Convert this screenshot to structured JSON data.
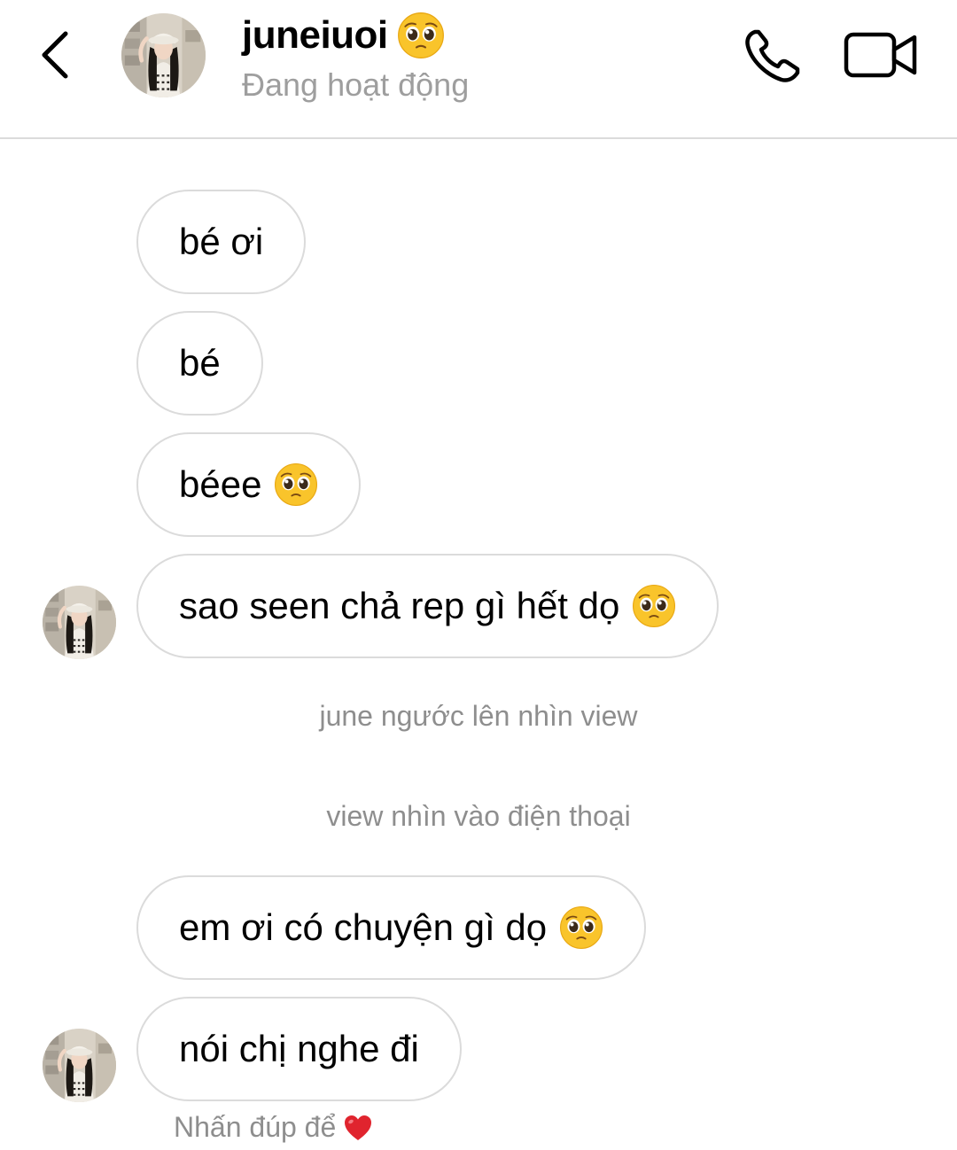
{
  "header": {
    "username": "juneiuoi",
    "status": "Đang hoạt động"
  },
  "messages": [
    {
      "text": "bé ơi"
    },
    {
      "text": "bé"
    },
    {
      "text": "béee"
    },
    {
      "text": "sao seen chả rep gì hết dọ"
    },
    {
      "text": "em ơi có chuyện gì dọ"
    },
    {
      "text": "nói chị nghe đi"
    }
  ],
  "narrations": [
    "june ngước lên nhìn view",
    "view nhìn vào điện thoại"
  ],
  "hint": {
    "text": "Nhấn đúp để"
  },
  "icons": {
    "back": "chevron-left-icon",
    "call": "phone-icon",
    "video": "video-camera-icon",
    "emoji": "pleading-face-emoji",
    "heart": "red-heart-emoji"
  },
  "colors": {
    "bubble_border": "#dbdbdb",
    "secondary_text": "#8e8e8e",
    "heart": "#e0242e"
  }
}
